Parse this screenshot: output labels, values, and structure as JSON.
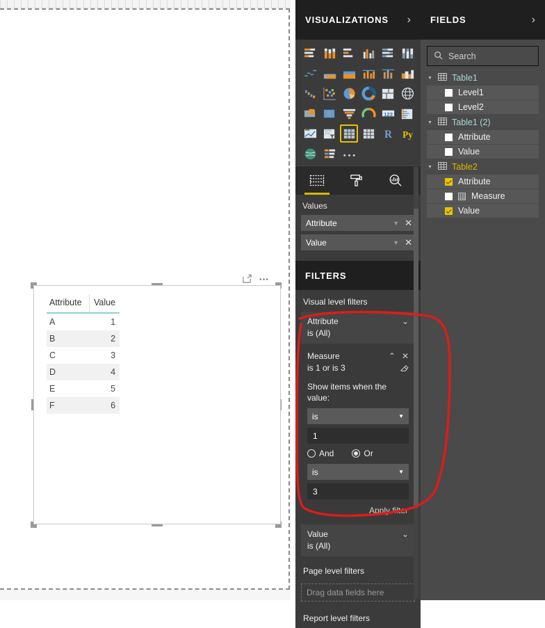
{
  "canvas": {
    "visual": {
      "columns": [
        "Attribute",
        "Value"
      ],
      "rows": [
        {
          "attribute": "A",
          "value": "1"
        },
        {
          "attribute": "B",
          "value": "2"
        },
        {
          "attribute": "C",
          "value": "3"
        },
        {
          "attribute": "D",
          "value": "4"
        },
        {
          "attribute": "E",
          "value": "5"
        },
        {
          "attribute": "F",
          "value": "6"
        }
      ],
      "toolbar": {
        "focus_icon": "focus-mode-icon",
        "more_icon": "more-options-icon"
      }
    }
  },
  "visualizations": {
    "title": "VISUALIZATIONS",
    "collapse_icon": "chevron-right-icon",
    "icons": [
      "stacked-bar-chart-icon",
      "stacked-column-chart-icon",
      "clustered-bar-chart-icon",
      "clustered-column-chart-icon",
      "100-stacked-bar-chart-icon",
      "100-stacked-column-chart-icon",
      "line-chart-icon",
      "area-chart-icon",
      "stacked-area-chart-icon",
      "line-stacked-column-chart-icon",
      "line-clustered-column-chart-icon",
      "ribbon-chart-icon",
      "waterfall-chart-icon",
      "scatter-chart-icon",
      "pie-chart-icon",
      "donut-chart-icon",
      "treemap-icon",
      "map-icon",
      "filled-map-icon",
      "shape-map-icon",
      "funnel-icon",
      "gauge-icon",
      "card-icon",
      "multi-row-card-icon",
      "kpi-icon",
      "slicer-icon",
      "table-icon",
      "matrix-icon",
      "r-script-visual-icon",
      "python-visual-icon",
      "arcgis-map-icon",
      "key-influencers-icon",
      "more-visuals-icon"
    ],
    "selected_icon": "table-icon",
    "tabs": [
      {
        "name": "fields-tab",
        "icon": "fields-grid-icon",
        "active": true
      },
      {
        "name": "format-tab",
        "icon": "paint-roller-icon",
        "active": false
      },
      {
        "name": "analytics-tab",
        "icon": "magnifier-chart-icon",
        "active": false
      }
    ],
    "wells": {
      "label": "Values",
      "chips": [
        {
          "name": "Attribute",
          "dropdown_icon": "caret-down-icon",
          "remove_icon": "close-icon"
        },
        {
          "name": "Value",
          "dropdown_icon": "caret-down-icon",
          "remove_icon": "close-icon"
        }
      ]
    }
  },
  "filters": {
    "title": "FILTERS",
    "visual_level_label": "Visual level filters",
    "cards": [
      {
        "field": "Attribute",
        "state": "is (All)",
        "expand_icon": "chevron-down-icon",
        "expanded": false
      },
      {
        "field": "Measure",
        "state": "is 1 or is 3",
        "collapse_icon": "chevron-up-icon",
        "remove_icon": "close-icon",
        "clear_icon": "eraser-icon",
        "expanded": true,
        "prompt": "Show items when the value:",
        "condition1_operator": "is",
        "condition1_value": "1",
        "logic_and_label": "And",
        "logic_or_label": "Or",
        "logic_selected": "Or",
        "condition2_operator": "is",
        "condition2_value": "3",
        "apply_label": "Apply filter"
      },
      {
        "field": "Value",
        "state": "is (All)",
        "expand_icon": "chevron-down-icon",
        "expanded": false
      }
    ],
    "page_level_label": "Page level filters",
    "page_level_dropzone": "Drag data fields here",
    "report_level_label": "Report level filters"
  },
  "fields": {
    "title": "FIELDS",
    "collapse_icon": "chevron-right-icon",
    "search": {
      "placeholder": "Search",
      "icon": "search-icon",
      "value": ""
    },
    "tables": [
      {
        "name": "Table1",
        "color": "teal",
        "expand_icon": "triangle-down-icon",
        "table_icon": "table-grid-icon",
        "items": [
          {
            "label": "Level1",
            "checked": false,
            "measure": false
          },
          {
            "label": "Level2",
            "checked": false,
            "measure": false
          }
        ]
      },
      {
        "name": "Table1 (2)",
        "color": "teal",
        "expand_icon": "triangle-down-icon",
        "table_icon": "table-grid-icon",
        "items": [
          {
            "label": "Attribute",
            "checked": false,
            "measure": false
          },
          {
            "label": "Value",
            "checked": false,
            "measure": false
          }
        ]
      },
      {
        "name": "Table2",
        "color": "gold",
        "expand_icon": "triangle-down-icon",
        "table_icon": "table-grid-icon",
        "items": [
          {
            "label": "Attribute",
            "checked": true,
            "measure": false
          },
          {
            "label": "Measure",
            "checked": false,
            "measure": true
          },
          {
            "label": "Value",
            "checked": true,
            "measure": false
          }
        ]
      }
    ]
  },
  "annotation": {
    "type": "hand-drawn-circle",
    "color": "#e01b1b",
    "target": "Measure visual level filter card"
  }
}
